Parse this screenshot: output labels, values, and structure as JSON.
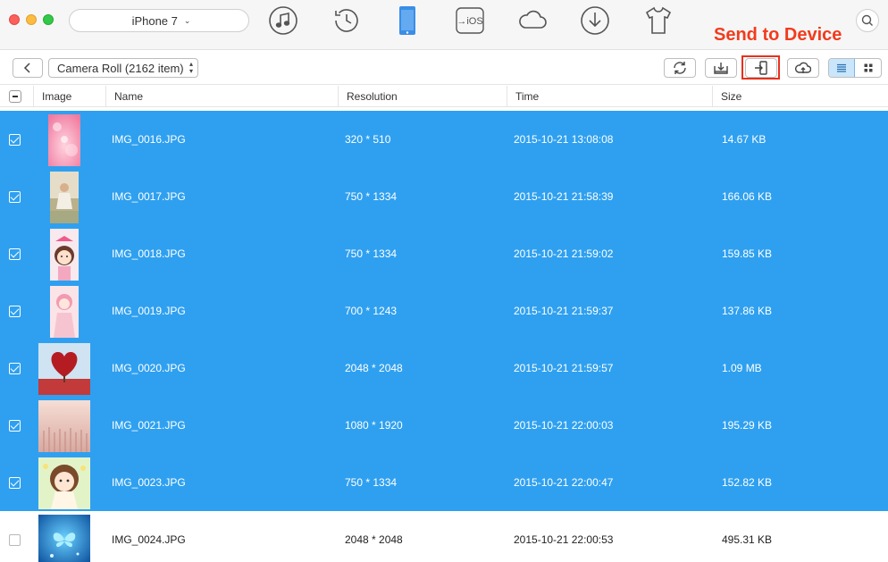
{
  "device": {
    "name": "iPhone 7",
    "apple_glyph": "",
    "chevron": "⌄"
  },
  "nav_icons": [
    "itunes-music-icon",
    "history-clock-icon",
    "device-phone-icon",
    "to-ios-icon",
    "icloud-icon",
    "download-icon",
    "shirt-icon"
  ],
  "nav_labels": {
    "to_ios": "→iOS"
  },
  "annotation": {
    "text": "Send to Device",
    "color": "#f23b1d"
  },
  "toolbar": {
    "album": "Camera Roll (2162 item)",
    "buttons": [
      "refresh-icon",
      "export-to-computer-icon",
      "send-to-device-icon",
      "upload-to-icloud-icon"
    ],
    "view_modes": [
      "list-view-icon",
      "grid-view-icon"
    ],
    "active_view": "list"
  },
  "columns": {
    "image": "Image",
    "name": "Name",
    "resolution": "Resolution",
    "time": "Time",
    "size": "Size"
  },
  "rows": [
    {
      "name": "IMG_0016.JPG",
      "resolution": "320 * 510",
      "time": "2015-10-21 13:08:08",
      "size": "14.67 KB",
      "selected": true,
      "thumb": "pink-bokeh"
    },
    {
      "name": "IMG_0017.JPG",
      "resolution": "750 * 1334",
      "time": "2015-10-21 21:58:39",
      "size": "166.06 KB",
      "selected": true,
      "thumb": "girl-field"
    },
    {
      "name": "IMG_0018.JPG",
      "resolution": "750 * 1334",
      "time": "2015-10-21 21:59:02",
      "size": "159.85 KB",
      "selected": true,
      "thumb": "cartoon-girl-bow"
    },
    {
      "name": "IMG_0019.JPG",
      "resolution": "700 * 1243",
      "time": "2015-10-21 21:59:37",
      "size": "137.86 KB",
      "selected": true,
      "thumb": "pink-girl"
    },
    {
      "name": "IMG_0020.JPG",
      "resolution": "2048 * 2048",
      "time": "2015-10-21 21:59:57",
      "size": "1.09 MB",
      "selected": true,
      "thumb": "red-heart-tree"
    },
    {
      "name": "IMG_0021.JPG",
      "resolution": "1080 * 1920",
      "time": "2015-10-21 22:00:03",
      "size": "195.29 KB",
      "selected": true,
      "thumb": "wheat-field"
    },
    {
      "name": "IMG_0023.JPG",
      "resolution": "750 * 1334",
      "time": "2015-10-21 22:00:47",
      "size": "152.82 KB",
      "selected": true,
      "thumb": "cartoon-girl-green"
    },
    {
      "name": "IMG_0024.JPG",
      "resolution": "2048 * 2048",
      "time": "2015-10-21 22:00:53",
      "size": "495.31 KB",
      "selected": false,
      "thumb": "blue-butterfly"
    }
  ],
  "colors": {
    "selection": "#2fa0f0",
    "highlight_box": "#e8301c",
    "active_view": "#c9e6fb",
    "accent": "#3a8ee6"
  }
}
